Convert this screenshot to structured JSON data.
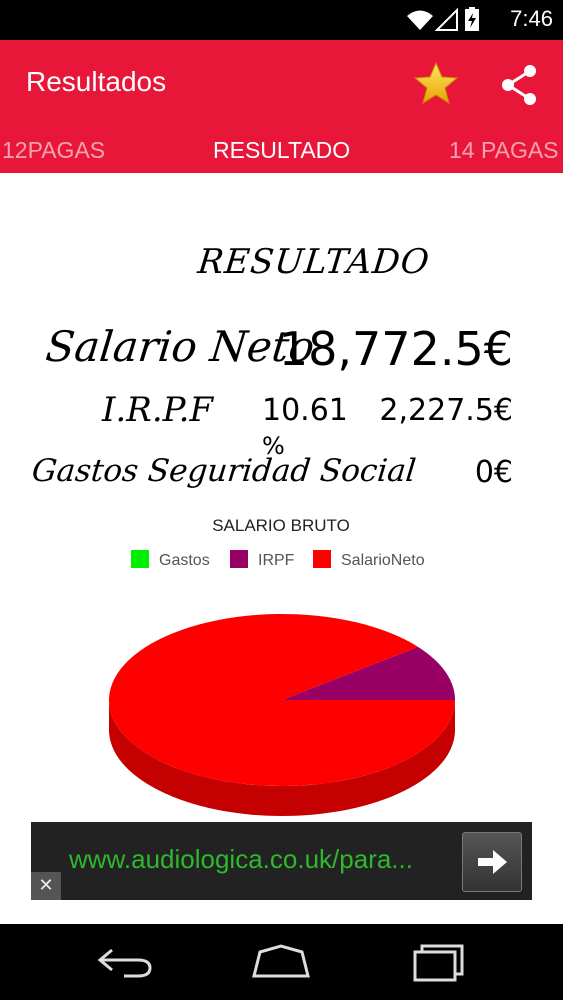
{
  "status_bar": {
    "time": "7:46"
  },
  "app_bar": {
    "title": "Resultados"
  },
  "tabs": [
    {
      "label": "12PAGAS"
    },
    {
      "label": "RESULTADO"
    },
    {
      "label": "14 PAGAS"
    }
  ],
  "result": {
    "heading": "RESULTADO",
    "neto_label": "Salario Neto",
    "neto_value": "18,772.5€",
    "irpf_label": "I.R.P.F",
    "irpf_percent": "10.61",
    "irpf_percent_symbol": "%",
    "irpf_value": "2,227.5€",
    "gastos_label": "Gastos Seguridad Social",
    "gastos_value": "0€"
  },
  "chart_data": {
    "type": "pie",
    "title": "SALARIO BRUTO",
    "legend_position": "top",
    "labels": [
      "Gastos",
      "IRPF",
      "SalarioNeto"
    ],
    "values": [
      0,
      2227.5,
      18772.5
    ],
    "colors": [
      "#00ee00",
      "#990066",
      "#ff0000"
    ]
  },
  "ad": {
    "text": "www.audiologica.co.uk/para..."
  },
  "colors": {
    "accent": "#e8173a"
  }
}
